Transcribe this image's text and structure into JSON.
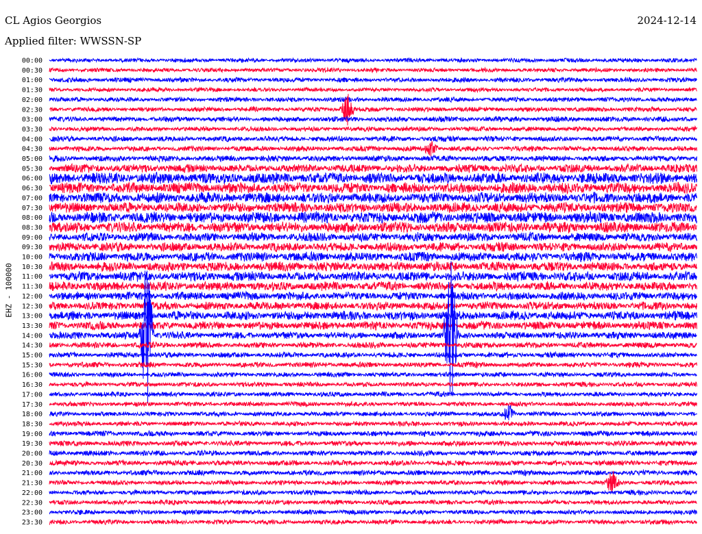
{
  "header": {
    "station": "CL Agios Georgios",
    "date": "2024-12-14",
    "filter_label": "Applied filter: WWSSN-SP"
  },
  "axis": {
    "ylabel": "EHZ - 100000"
  },
  "colors": {
    "trace_a": "#0000ff",
    "trace_b": "#ff0033"
  },
  "chart_data": {
    "type": "line",
    "chart_kind": "helicorder (seismogram drum plot)",
    "channel": "EHZ",
    "row_labels": [
      "00:00",
      "00:30",
      "01:00",
      "01:30",
      "02:00",
      "02:30",
      "03:00",
      "03:30",
      "04:00",
      "04:30",
      "05:00",
      "05:30",
      "06:00",
      "06:30",
      "07:00",
      "07:30",
      "08:00",
      "08:30",
      "09:00",
      "09:30",
      "10:00",
      "10:30",
      "11:00",
      "11:30",
      "12:00",
      "12:30",
      "13:00",
      "13:30",
      "14:00",
      "14:30",
      "15:00",
      "15:30",
      "16:00",
      "16:30",
      "17:00",
      "17:30",
      "18:00",
      "18:30",
      "19:00",
      "19:30",
      "20:00",
      "20:30",
      "21:00",
      "21:30",
      "22:00",
      "22:30",
      "23:00",
      "23:30"
    ],
    "row_color_order": [
      "blue",
      "red"
    ],
    "relative_amplitude_per_row": [
      0.35,
      0.35,
      0.4,
      0.35,
      0.4,
      0.4,
      0.45,
      0.4,
      0.45,
      0.45,
      0.5,
      0.7,
      0.95,
      0.9,
      0.9,
      0.85,
      0.95,
      0.9,
      0.75,
      0.75,
      0.8,
      0.8,
      0.8,
      0.75,
      0.7,
      0.7,
      0.75,
      0.7,
      0.6,
      0.5,
      0.45,
      0.45,
      0.4,
      0.4,
      0.4,
      0.4,
      0.4,
      0.4,
      0.45,
      0.45,
      0.45,
      0.45,
      0.45,
      0.4,
      0.4,
      0.4,
      0.4,
      0.4
    ],
    "events": [
      {
        "row": "02:30",
        "x_fraction": 0.46,
        "relative_amplitude": 3.5
      },
      {
        "row": "04:30",
        "x_fraction": 0.59,
        "relative_amplitude": 1.6
      },
      {
        "row": "14:00",
        "x_fraction": 0.15,
        "relative_amplitude": 18.0
      },
      {
        "row": "14:00",
        "x_fraction": 0.62,
        "relative_amplitude": 16.0
      },
      {
        "row": "18:00",
        "x_fraction": 0.71,
        "relative_amplitude": 1.8
      },
      {
        "row": "21:30",
        "x_fraction": 0.87,
        "relative_amplitude": 2.2
      }
    ],
    "grid": false,
    "legend": "none"
  }
}
